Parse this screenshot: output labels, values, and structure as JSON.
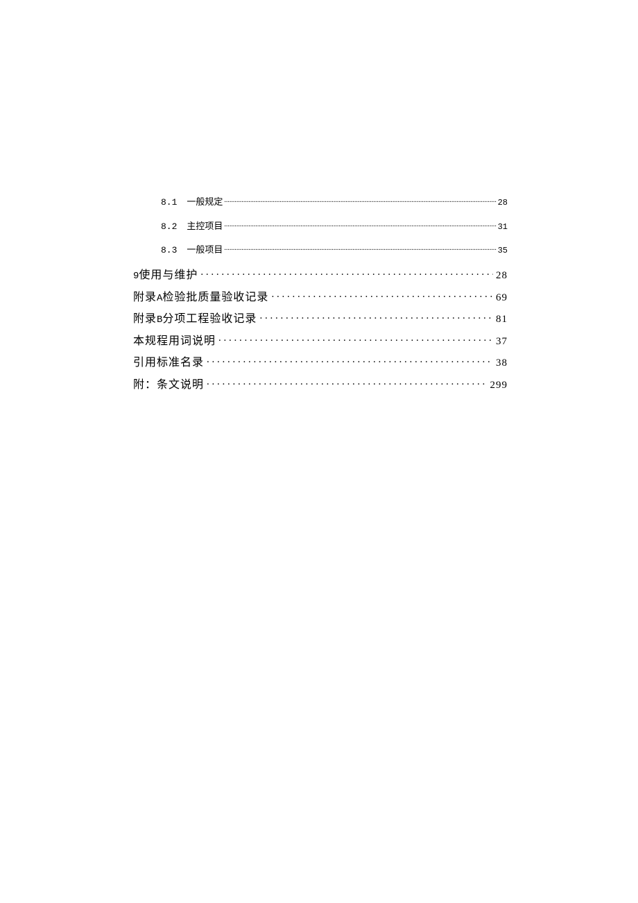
{
  "toc": {
    "sub": [
      {
        "num": "8.1",
        "label": "一般规定",
        "page": "28"
      },
      {
        "num": "8.2",
        "label": "主控项目",
        "page": "31"
      },
      {
        "num": "8.3",
        "label": "一般项目",
        "page": "35"
      }
    ],
    "main": [
      {
        "prefix_small": "9",
        "label": "使用与维护",
        "page": "28"
      },
      {
        "prefix": "附录",
        "mid_small": "A",
        "label": "检验批质量验收记录",
        "page": "69"
      },
      {
        "prefix": "附录",
        "mid_small": "B",
        "label": "分项工程验收记录",
        "page": "81"
      },
      {
        "label": "本规程用词说明",
        "page": "37"
      },
      {
        "label": "引用标准名录",
        "page": "38"
      },
      {
        "label": "附：条文说明",
        "page": "299"
      }
    ]
  }
}
